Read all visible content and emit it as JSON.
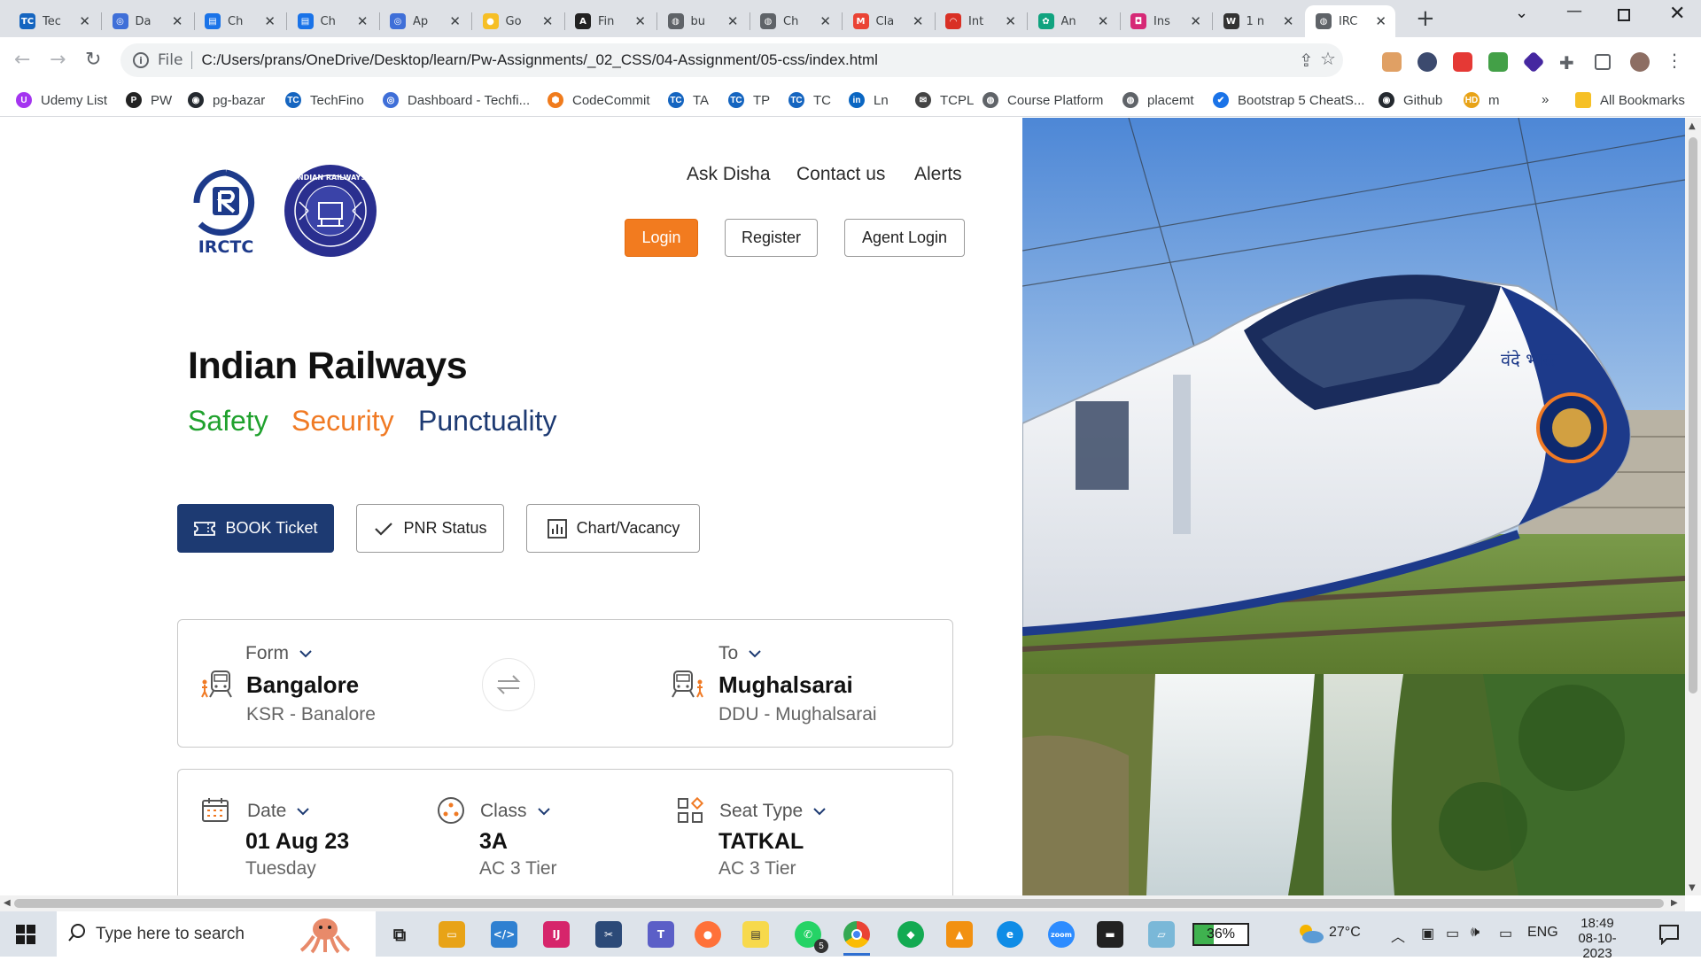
{
  "browser": {
    "tabs": [
      {
        "title": "Tec",
        "icon": "techfino-icon",
        "color": "#1565c0",
        "glyph": "TC"
      },
      {
        "title": "Da",
        "icon": "swirl-icon",
        "color": "#3f6fd8",
        "glyph": "◎"
      },
      {
        "title": "Ch",
        "icon": "chart-icon",
        "color": "#1a73e8",
        "glyph": "▤"
      },
      {
        "title": "Ch",
        "icon": "chart-icon",
        "color": "#1a73e8",
        "glyph": "▤"
      },
      {
        "title": "Ap",
        "icon": "swirl-icon",
        "color": "#3f6fd8",
        "glyph": "◎"
      },
      {
        "title": "Go",
        "icon": "google-keep-icon",
        "color": "#f6bf26",
        "glyph": "●"
      },
      {
        "title": "Fin",
        "icon": "find-icon",
        "color": "#222222",
        "glyph": "A"
      },
      {
        "title": "bu",
        "icon": "globe-icon",
        "color": "#5f6368",
        "glyph": "◍"
      },
      {
        "title": "Ch",
        "icon": "globe-icon",
        "color": "#5f6368",
        "glyph": "◍"
      },
      {
        "title": "Cla",
        "icon": "gmail-icon",
        "color": "#ea4335",
        "glyph": "M"
      },
      {
        "title": "Int",
        "icon": "speedometer-icon",
        "color": "#d93025",
        "glyph": "◠"
      },
      {
        "title": "An",
        "icon": "openai-icon",
        "color": "#10a37f",
        "glyph": "✿"
      },
      {
        "title": "Ins",
        "icon": "instagram-icon",
        "color": "#d62976",
        "glyph": "◘"
      },
      {
        "title": "1 n",
        "icon": "wordpress-icon",
        "color": "#333333",
        "glyph": "W"
      },
      {
        "title": "IRC",
        "icon": "globe-icon",
        "color": "#5f6368",
        "glyph": "◍"
      }
    ],
    "address_scheme": "File",
    "url": "C:/Users/prans/OneDrive/Desktop/learn/Pw-Assignments/_02_CSS/04-Assignment/05-css/index.html",
    "bookmarks": [
      {
        "label": "Udemy List",
        "icon": "udemy-icon",
        "color": "#a435f0",
        "glyph": "U"
      },
      {
        "label": "PW",
        "icon": "pw-icon",
        "color": "#222222",
        "glyph": "P"
      },
      {
        "label": "pg-bazar",
        "icon": "github-icon",
        "color": "#24292f",
        "glyph": "◉"
      },
      {
        "label": "TechFino",
        "icon": "techfino-icon",
        "color": "#1565c0",
        "glyph": "TC"
      },
      {
        "label": "Dashboard - Techfi...",
        "icon": "swirl-icon",
        "color": "#3f6fd8",
        "glyph": "◎"
      },
      {
        "label": "CodeCommit",
        "icon": "aws-icon",
        "color": "#f07b1c",
        "glyph": "⬢"
      },
      {
        "label": "TA",
        "icon": "techfino-icon",
        "color": "#1565c0",
        "glyph": "TC"
      },
      {
        "label": "TP",
        "icon": "techfino-icon",
        "color": "#1565c0",
        "glyph": "TC"
      },
      {
        "label": "TC",
        "icon": "techfino-icon",
        "color": "#1565c0",
        "glyph": "TC"
      },
      {
        "label": "Ln",
        "icon": "linkedin-icon",
        "color": "#0a66c2",
        "glyph": "in"
      },
      {
        "label": "TCPL",
        "icon": "mail-icon",
        "color": "#444444",
        "glyph": "✉"
      },
      {
        "label": "Course Platform",
        "icon": "globe-icon",
        "color": "#5f6368",
        "glyph": "◍"
      },
      {
        "label": "placemt",
        "icon": "globe-icon",
        "color": "#5f6368",
        "glyph": "◍"
      },
      {
        "label": "Bootstrap 5 CheatS...",
        "icon": "check-icon",
        "color": "#1a73e8",
        "glyph": "✔"
      },
      {
        "label": "Github",
        "icon": "github-icon",
        "color": "#24292f",
        "glyph": "◉"
      },
      {
        "label": "m",
        "icon": "hd-icon",
        "color": "#e8a317",
        "glyph": "HD"
      }
    ],
    "more_bookmarks": "»",
    "all_bookmarks": "All Bookmarks"
  },
  "page": {
    "logo_text": "IRCTC",
    "emblem_text": "INDIAN RAILWAYS",
    "nav": [
      "Ask Disha",
      "Contact us",
      "Alerts"
    ],
    "login": "Login",
    "register": "Register",
    "agent_login": "Agent Login",
    "hero_title": "Indian Railways",
    "motto": [
      {
        "text": "Safety",
        "color": "#1fa12d"
      },
      {
        "text": "Security",
        "color": "#f07a24"
      },
      {
        "text": "Punctuality",
        "color": "#1d3a72"
      }
    ],
    "actions": {
      "book": "BOOK Ticket",
      "pnr": "PNR Status",
      "chart": "Chart/Vacancy"
    },
    "journey": {
      "from_label": "Form",
      "from_city": "Bangalore",
      "from_code": "KSR - Banalore",
      "to_label": "To",
      "to_city": "Mughalsarai",
      "to_code": "DDU - Mughalsarai"
    },
    "details": {
      "date_label": "Date",
      "date_value": "01 Aug 23",
      "date_day": "Tuesday",
      "class_label": "Class",
      "class_value": "3A",
      "class_sub": "AC 3 Tier",
      "seat_label": "Seat Type",
      "seat_value": "TATKAL",
      "seat_sub": "AC 3 Tier"
    },
    "train_text": "वंदे भारत"
  },
  "taskbar": {
    "search_placeholder": "Type here to search",
    "battery": "36%",
    "temperature": "27°C",
    "language": "ENG",
    "time": "18:49",
    "date": "08-10-2023",
    "whatsapp_badge": "5"
  },
  "colors": {
    "accent_orange": "#f27b1f",
    "book_blue": "#1d3a72"
  }
}
